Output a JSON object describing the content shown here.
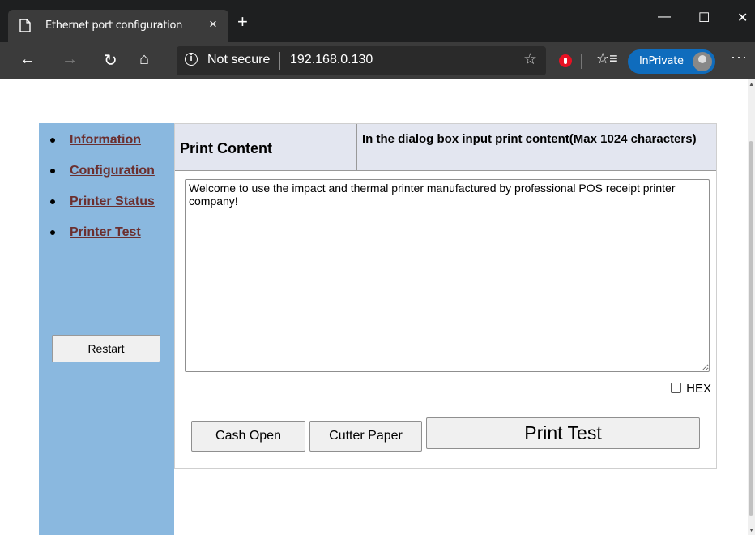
{
  "browser": {
    "tab_title": "Ethernet port configuration",
    "tab_close": "×",
    "new_tab": "+",
    "window_buttons": {
      "minimize": "—",
      "maximize": "☐",
      "close": "✕"
    },
    "nav": {
      "back": "←",
      "forward": "→",
      "refresh": "↻",
      "home": "⌂"
    },
    "address": {
      "security": "Not secure",
      "url": "192.168.0.130",
      "info_glyph": "i"
    },
    "favorite_glyph": "☆",
    "favorites_glyph": "☆≡",
    "inprivate_label": "InPrivate",
    "more_glyph": "···",
    "icons": [
      "page-icon",
      "back-icon",
      "forward-icon",
      "refresh-icon",
      "home-icon",
      "info-icon",
      "star-icon",
      "extension-icon",
      "favorites-icon",
      "profile-avatar-icon",
      "more-icon"
    ]
  },
  "sidebar": {
    "links": [
      {
        "label": "Information"
      },
      {
        "label": "Configuration"
      },
      {
        "label": "Printer Status"
      },
      {
        "label": "Printer Test"
      }
    ],
    "restart_label": "Restart"
  },
  "panel": {
    "header_title": "Print Content",
    "header_desc": "In the dialog box input print content(Max 1024 characters)",
    "content_value": "Welcome to use the impact and thermal printer manufactured by professional POS receipt printer company!",
    "hex_label": "HEX",
    "hex_checked": false,
    "buttons": {
      "cash_open": "Cash Open",
      "cutter_paper": "Cutter Paper",
      "print_test": "Print Test"
    }
  },
  "colors": {
    "sidebar_bg": "#8ab8df",
    "header_bg": "#e3e6f0",
    "link_color": "#6b2f2f",
    "inprivate_bg": "#0f6cbd"
  }
}
